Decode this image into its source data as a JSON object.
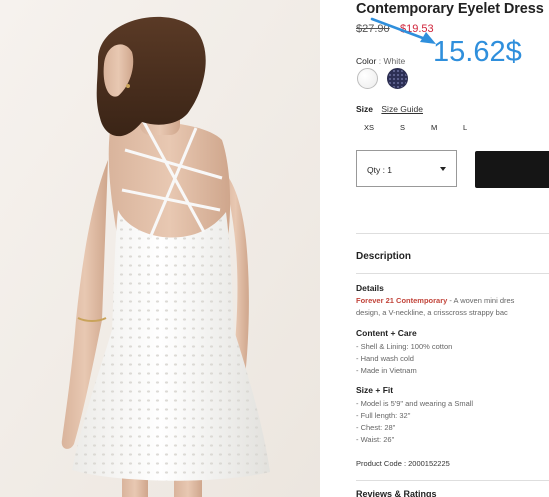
{
  "product": {
    "title": "Contemporary Eyelet Dress",
    "price_original": "$27.90",
    "price_sale": "$19.53"
  },
  "annotation": {
    "price_text": "15.62$",
    "color": "#2f8fdc"
  },
  "color": {
    "label": "Color",
    "separator": ":",
    "selected": "White",
    "swatches": [
      {
        "name": "White",
        "color": "#f4f4f4"
      },
      {
        "name": "Navy",
        "color": "#2c2f55"
      }
    ]
  },
  "size": {
    "label": "Size",
    "guide_label": "Size Guide",
    "options": [
      "XS",
      "S",
      "M",
      "L"
    ]
  },
  "quantity": {
    "label": "Qty : 1"
  },
  "description": {
    "header": "Description",
    "details_header": "Details",
    "details_brand": "Forever 21 Contemporary",
    "details_line1": " - A woven mini dres",
    "details_line2": "design, a V-neckline, a crisscross strappy bac",
    "content_header": "Content + Care",
    "content_items": [
      "- Shell & Lining: 100% cotton",
      "- Hand wash cold",
      "- Made in Vietnam"
    ],
    "size_fit_header": "Size + Fit",
    "size_fit_items": [
      "- Model is 5'9\" and wearing a Small",
      "- Full length: 32\"",
      "- Chest: 28\"",
      "- Waist: 26\""
    ],
    "product_code": "Product Code : 2000152225"
  },
  "reviews": {
    "header": "Reviews & Ratings"
  },
  "colors": {
    "sale_red": "#d0243a",
    "brand_red": "#c2453b",
    "button_black": "#151515"
  }
}
